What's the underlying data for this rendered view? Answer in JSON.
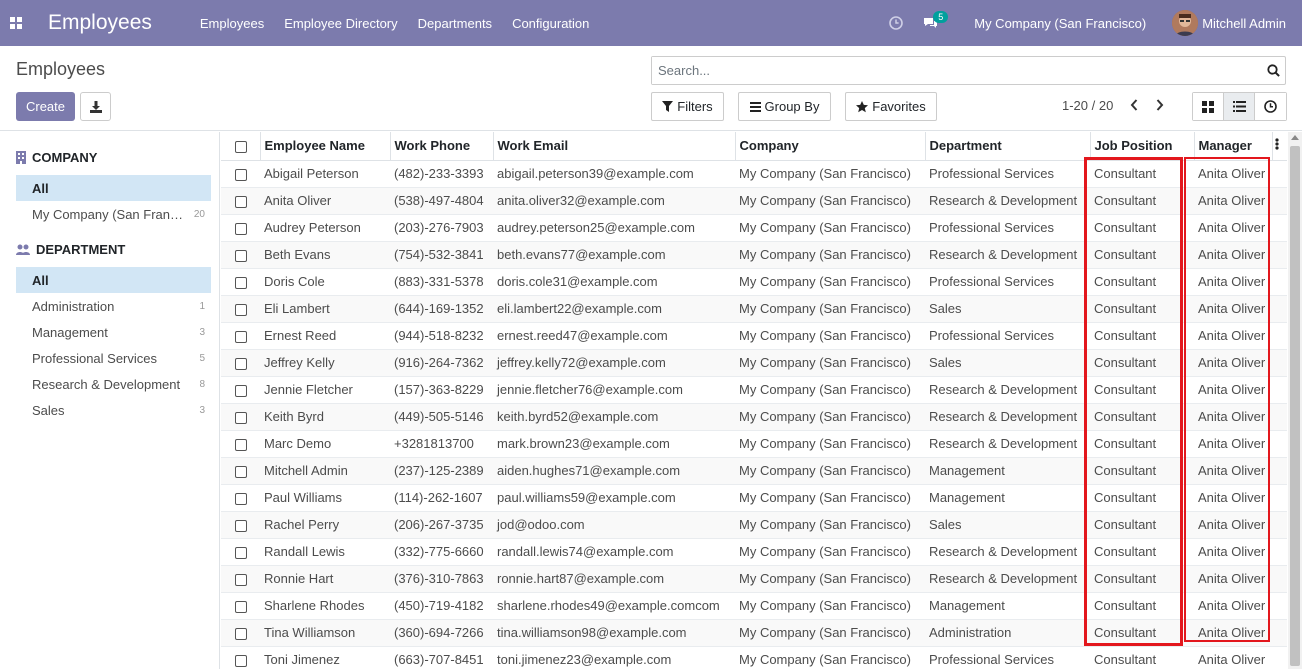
{
  "navbar": {
    "app_title": "Employees",
    "menu": [
      "Employees",
      "Employee Directory",
      "Departments",
      "Configuration"
    ],
    "chat_count": "5",
    "company": "My Company (San Francisco)",
    "user": "Mitchell Admin"
  },
  "control": {
    "breadcrumb": "Employees",
    "create_label": "Create",
    "search_placeholder": "Search...",
    "filters_label": "Filters",
    "groupby_label": "Group By",
    "favorites_label": "Favorites",
    "pager": "1-20 / 20"
  },
  "sidebar": {
    "company_header": "COMPANY",
    "company_items": [
      {
        "label": "All",
        "count": ""
      },
      {
        "label": "My Company (San Francisco)",
        "count": "20"
      }
    ],
    "department_header": "DEPARTMENT",
    "department_items": [
      {
        "label": "All",
        "count": ""
      },
      {
        "label": "Administration",
        "count": "1"
      },
      {
        "label": "Management",
        "count": "3"
      },
      {
        "label": "Professional Services",
        "count": "5"
      },
      {
        "label": "Research & Development",
        "count": "8"
      },
      {
        "label": "Sales",
        "count": "3"
      }
    ]
  },
  "table": {
    "columns": [
      "Employee Name",
      "Work Phone",
      "Work Email",
      "Company",
      "Department",
      "Job Position",
      "Manager"
    ],
    "rows": [
      [
        "Abigail Peterson",
        "(482)-233-3393",
        "abigail.peterson39@example.com",
        "My Company (San Francisco)",
        "Professional Services",
        "Consultant",
        "Anita Oliver"
      ],
      [
        "Anita Oliver",
        "(538)-497-4804",
        "anita.oliver32@example.com",
        "My Company (San Francisco)",
        "Research & Development",
        "Consultant",
        "Anita Oliver"
      ],
      [
        "Audrey Peterson",
        "(203)-276-7903",
        "audrey.peterson25@example.com",
        "My Company (San Francisco)",
        "Professional Services",
        "Consultant",
        "Anita Oliver"
      ],
      [
        "Beth Evans",
        "(754)-532-3841",
        "beth.evans77@example.com",
        "My Company (San Francisco)",
        "Research & Development",
        "Consultant",
        "Anita Oliver"
      ],
      [
        "Doris Cole",
        "(883)-331-5378",
        "doris.cole31@example.com",
        "My Company (San Francisco)",
        "Professional Services",
        "Consultant",
        "Anita Oliver"
      ],
      [
        "Eli Lambert",
        "(644)-169-1352",
        "eli.lambert22@example.com",
        "My Company (San Francisco)",
        "Sales",
        "Consultant",
        "Anita Oliver"
      ],
      [
        "Ernest Reed",
        "(944)-518-8232",
        "ernest.reed47@example.com",
        "My Company (San Francisco)",
        "Professional Services",
        "Consultant",
        "Anita Oliver"
      ],
      [
        "Jeffrey Kelly",
        "(916)-264-7362",
        "jeffrey.kelly72@example.com",
        "My Company (San Francisco)",
        "Sales",
        "Consultant",
        "Anita Oliver"
      ],
      [
        "Jennie Fletcher",
        "(157)-363-8229",
        "jennie.fletcher76@example.com",
        "My Company (San Francisco)",
        "Research & Development",
        "Consultant",
        "Anita Oliver"
      ],
      [
        "Keith Byrd",
        "(449)-505-5146",
        "keith.byrd52@example.com",
        "My Company (San Francisco)",
        "Research & Development",
        "Consultant",
        "Anita Oliver"
      ],
      [
        "Marc Demo",
        "+3281813700",
        "mark.brown23@example.com",
        "My Company (San Francisco)",
        "Research & Development",
        "Consultant",
        "Anita Oliver"
      ],
      [
        "Mitchell Admin",
        "(237)-125-2389",
        "aiden.hughes71@example.com",
        "My Company (San Francisco)",
        "Management",
        "Consultant",
        "Anita Oliver"
      ],
      [
        "Paul Williams",
        "(114)-262-1607",
        "paul.williams59@example.com",
        "My Company (San Francisco)",
        "Management",
        "Consultant",
        "Anita Oliver"
      ],
      [
        "Rachel Perry",
        "(206)-267-3735",
        "jod@odoo.com",
        "My Company (San Francisco)",
        "Sales",
        "Consultant",
        "Anita Oliver"
      ],
      [
        "Randall Lewis",
        "(332)-775-6660",
        "randall.lewis74@example.com",
        "My Company (San Francisco)",
        "Research & Development",
        "Consultant",
        "Anita Oliver"
      ],
      [
        "Ronnie Hart",
        "(376)-310-7863",
        "ronnie.hart87@example.com",
        "My Company (San Francisco)",
        "Research & Development",
        "Consultant",
        "Anita Oliver"
      ],
      [
        "Sharlene Rhodes",
        "(450)-719-4182",
        "sharlene.rhodes49@example.comcom",
        "My Company (San Francisco)",
        "Management",
        "Consultant",
        "Anita Oliver"
      ],
      [
        "Tina Williamson",
        "(360)-694-7266",
        "tina.williamson98@example.com",
        "My Company (San Francisco)",
        "Administration",
        "Consultant",
        "Anita Oliver"
      ],
      [
        "Toni Jimenez",
        "(663)-707-8451",
        "toni.jimenez23@example.com",
        "My Company (San Francisco)",
        "Professional Services",
        "Consultant",
        "Anita Oliver"
      ]
    ]
  },
  "colors": {
    "brand": "#7c7bad",
    "highlight": "#e3171d",
    "active_filter": "#d2e6f5"
  }
}
